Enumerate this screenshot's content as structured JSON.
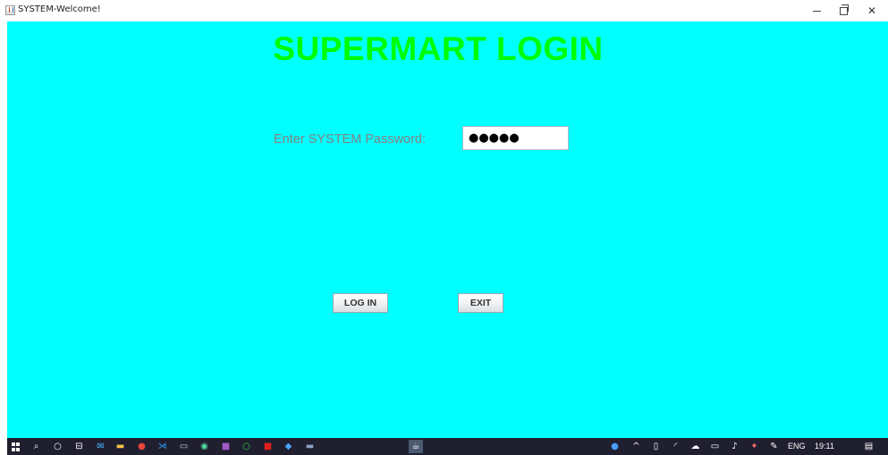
{
  "window": {
    "title": "SYSTEM-Welcome!",
    "minimize_glyph": "—",
    "close_glyph": "✕"
  },
  "main": {
    "title": "SUPERMART LOGIN",
    "password_label": "Enter SYSTEM Password:",
    "password_value": "●●●●●",
    "login_label": "LOG IN",
    "exit_label": "EXIT"
  },
  "taskbar": {
    "language": "ENG",
    "time": "19:11",
    "icons": [
      "windows-start-icon",
      "search-icon",
      "cortana-icon",
      "task-view-icon",
      "mail-icon",
      "file-explorer-icon",
      "chrome-icon",
      "vscode-icon",
      "terminal-icon",
      "app-icon",
      "onenote-icon",
      "circle-app-icon",
      "acrobat-icon",
      "app-cube-icon",
      "app-window-icon",
      "java-app-icon"
    ],
    "tray": [
      "help-icon",
      "chevron-up-icon",
      "tray-app-icon",
      "network-icon",
      "onedrive-icon",
      "battery-icon",
      "volume-icon",
      "dropbox-icon",
      "pen-icon",
      "notification-icon"
    ]
  },
  "colors": {
    "panel_bg": "#00ffff",
    "title_color": "#00ff00",
    "label_color": "#828282",
    "taskbar_bg": "#1f1f30"
  }
}
